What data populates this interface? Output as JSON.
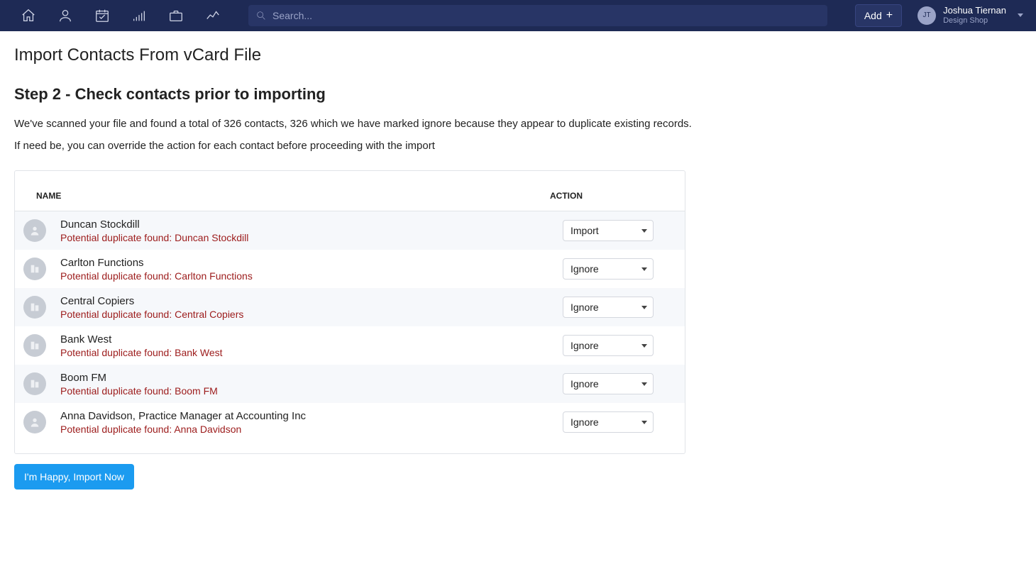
{
  "nav": {
    "search_placeholder": "Search...",
    "add_label": "Add",
    "user_initials": "JT",
    "user_name": "Joshua Tiernan",
    "user_org": "Design Shop"
  },
  "page": {
    "title": "Import Contacts From vCard File",
    "step_title": "Step 2 - Check contacts prior to importing",
    "desc_line1": "We've scanned your file and found a total of 326 contacts, 326 which we have marked ignore because they appear to duplicate existing records.",
    "desc_line2": "If need be, you can override the action for each contact before proceeding with the import",
    "import_button": "I'm Happy, Import Now"
  },
  "table": {
    "col_name": "NAME",
    "col_action": "ACTION",
    "dup_prefix": "Potential duplicate found: ",
    "rows": [
      {
        "icon": "person",
        "name": "Duncan Stockdill",
        "dup": "Duncan Stockdill",
        "action": "Import"
      },
      {
        "icon": "org",
        "name": "Carlton Functions",
        "dup": "Carlton Functions",
        "action": "Ignore"
      },
      {
        "icon": "org",
        "name": "Central Copiers",
        "dup": "Central Copiers",
        "action": "Ignore"
      },
      {
        "icon": "org",
        "name": "Bank West",
        "dup": "Bank West",
        "action": "Ignore"
      },
      {
        "icon": "org",
        "name": "Boom FM",
        "dup": "Boom FM",
        "action": "Ignore"
      },
      {
        "icon": "person",
        "name": "Anna Davidson, Practice Manager at Accounting Inc",
        "dup": "Anna Davidson",
        "action": "Ignore"
      }
    ],
    "action_options": [
      "Import",
      "Ignore"
    ]
  }
}
